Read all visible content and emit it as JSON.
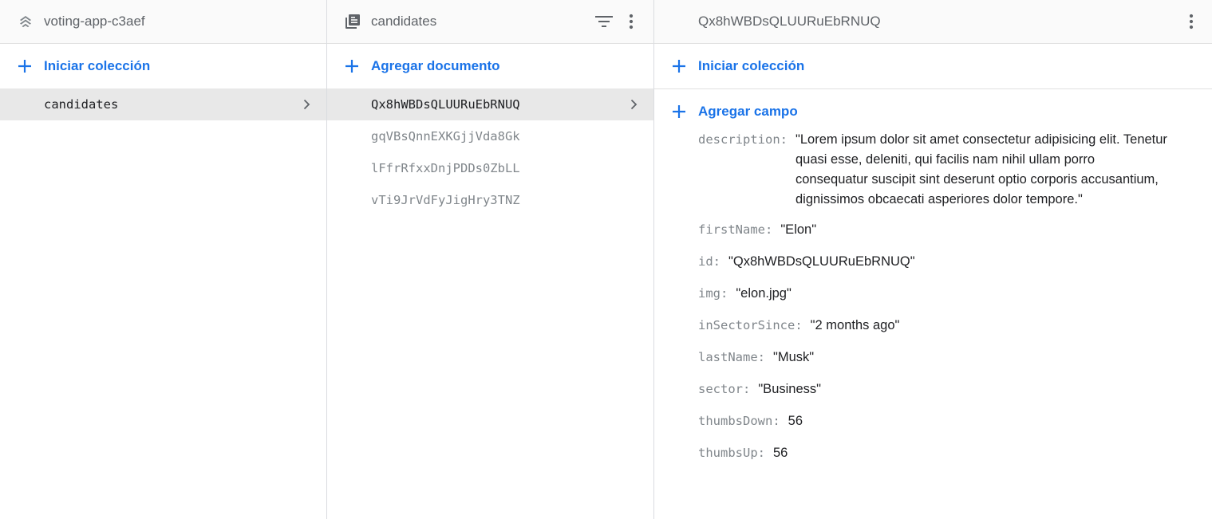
{
  "panel1": {
    "title": "voting-app-c3aef",
    "header_icon": "firestore-stack-icon",
    "action_label": "Iniciar colección",
    "items": [
      {
        "label": "candidates",
        "selected": true
      }
    ]
  },
  "panel2": {
    "title": "candidates",
    "header_icon": "collection-icon",
    "action_label": "Agregar documento",
    "items": [
      {
        "label": "Qx8hWBDsQLUURuEbRNUQ",
        "selected": true
      },
      {
        "label": "gqVBsQnnEXKGjjVda8Gk",
        "selected": false
      },
      {
        "label": "lFfrRfxxDnjPDDs0ZbLL",
        "selected": false
      },
      {
        "label": "vTi9JrVdFyJigHry3TNZ",
        "selected": false
      }
    ]
  },
  "panel3": {
    "title": "Qx8hWBDsQLUURuEbRNUQ",
    "action_collection_label": "Iniciar colección",
    "action_field_label": "Agregar campo",
    "fields": [
      {
        "key": "description:",
        "value": "\"Lorem ipsum dolor sit amet consectetur adipisicing elit. Tenetur quasi esse, deleniti, qui facilis nam nihil ullam porro consequatur suscipit sint deserunt optio corporis accusantium, dignissimos obcaecati asperiores dolor tempore.\""
      },
      {
        "key": "firstName:",
        "value": "\"Elon\""
      },
      {
        "key": "id:",
        "value": "\"Qx8hWBDsQLUURuEbRNUQ\""
      },
      {
        "key": "img:",
        "value": "\"elon.jpg\""
      },
      {
        "key": "inSectorSince:",
        "value": "\"2 months ago\""
      },
      {
        "key": "lastName:",
        "value": "\"Musk\""
      },
      {
        "key": "sector:",
        "value": "\"Business\""
      },
      {
        "key": "thumbsDown:",
        "value": "56"
      },
      {
        "key": "thumbsUp:",
        "value": "56"
      }
    ]
  },
  "colors": {
    "accent": "#1a73e8",
    "selected_bg": "#e8e8e8",
    "muted_text": "#80868b",
    "header_bg": "#fafafa",
    "border": "#dadce0"
  }
}
